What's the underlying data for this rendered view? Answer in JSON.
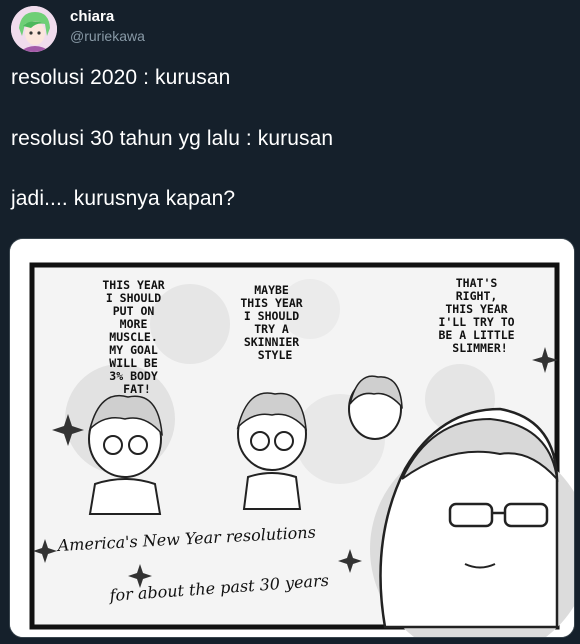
{
  "author": {
    "name": "chiara",
    "handle": "@ruriekawa"
  },
  "tweet_lines": [
    "resolusi 2020 : kurusan",
    "resolusi 30 tahun yg lalu : kurusan",
    "jadi.... kurusnya kapan?"
  ],
  "comic": {
    "bubble_left": [
      "THIS YEAR",
      "I SHOULD",
      "PUT ON",
      "MORE",
      "MUSCLE.",
      "MY GOAL",
      "WILL BE",
      "3% BODY",
      "FAT!"
    ],
    "bubble_middle": [
      "MAYBE",
      "THIS YEAR",
      "I SHOULD",
      "TRY A",
      "SKINNIER",
      "STYLE"
    ],
    "bubble_right": [
      "THAT'S",
      "RIGHT,",
      "THIS YEAR",
      "I'LL TRY TO",
      "BE A LITTLE",
      "SLIMMER!"
    ],
    "caption_line1": "America's New Year resolutions",
    "caption_line2": "for about the past 30 years"
  }
}
